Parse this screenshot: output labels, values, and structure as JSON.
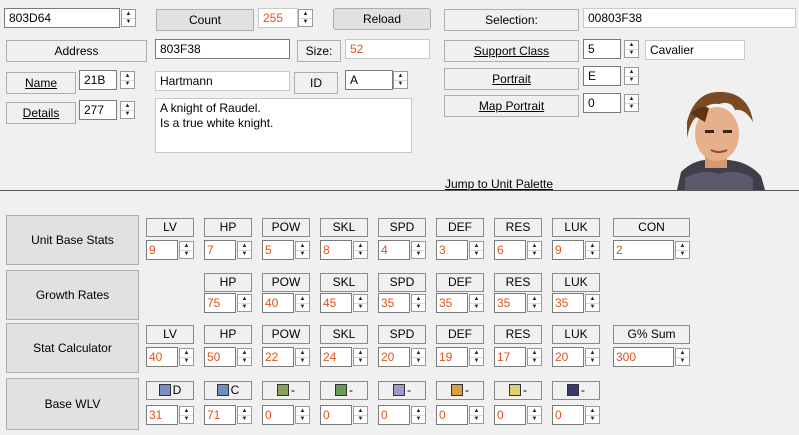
{
  "top": {
    "address_value": "803D64",
    "count_label": "Count",
    "count_value": "255",
    "reload_label": "Reload",
    "selection_label": "Selection:",
    "selection_value": "00803F38",
    "address_label": "Address",
    "address_field": "803F38",
    "size_label": "Size:",
    "size_value": "52",
    "name_label": "Name",
    "name_value": "21B",
    "name_text": "Hartmann",
    "id_label": "ID",
    "id_value": "A",
    "details_label": "Details",
    "details_value": "277",
    "details_text": "A knight of Raudel.\nIs a true white knight.",
    "support_class_label": "Support Class",
    "support_class_value": "5",
    "class_name": "Cavalier",
    "portrait_label": "Portrait",
    "portrait_value": "E",
    "map_portrait_label": "Map Portrait",
    "map_portrait_value": "0",
    "jump_link": "Jump to Unit Palette"
  },
  "base_stats": {
    "label": "Unit Base Stats",
    "headers": [
      "LV",
      "HP",
      "POW",
      "SKL",
      "SPD",
      "DEF",
      "RES",
      "LUK",
      "CON"
    ],
    "values": [
      "9",
      "7",
      "5",
      "8",
      "4",
      "3",
      "6",
      "9",
      "2"
    ]
  },
  "growth": {
    "label": "Growth Rates",
    "headers": [
      "HP",
      "POW",
      "SKL",
      "SPD",
      "DEF",
      "RES",
      "LUK"
    ],
    "values": [
      "75",
      "40",
      "45",
      "35",
      "35",
      "35",
      "35"
    ]
  },
  "calc": {
    "label": "Stat Calculator",
    "headers": [
      "LV",
      "HP",
      "POW",
      "SKL",
      "SPD",
      "DEF",
      "RES",
      "LUK",
      "G% Sum"
    ],
    "values": [
      "40",
      "50",
      "22",
      "24",
      "20",
      "19",
      "17",
      "20",
      "300"
    ]
  },
  "wlv": {
    "label": "Base WLV",
    "headers": [
      "D",
      "C",
      "-",
      "-",
      "-",
      "-",
      "-",
      "-"
    ],
    "icons": [
      "sword-icon",
      "lance-icon",
      "axe-icon",
      "bow-icon",
      "staff-icon",
      "anima-icon",
      "light-icon",
      "dark-icon"
    ],
    "values": [
      "31",
      "71",
      "0",
      "0",
      "0",
      "0",
      "0",
      "0"
    ]
  }
}
